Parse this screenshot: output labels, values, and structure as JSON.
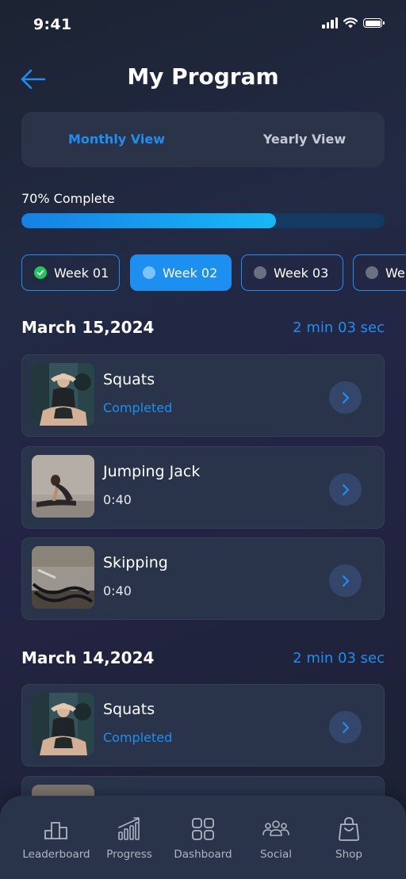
{
  "status_bar": {
    "time": "9:41"
  },
  "header": {
    "title": "My Program"
  },
  "view_toggle": {
    "active": "Monthly View",
    "inactive": "Yearly View"
  },
  "progress": {
    "label": "70% Complete",
    "value": 0.7
  },
  "weeks": [
    {
      "label": "Week 01",
      "state": "completed"
    },
    {
      "label": "Week 02",
      "state": "active"
    },
    {
      "label": "Week 03",
      "state": "upcoming"
    },
    {
      "label": "We",
      "state": "upcoming"
    }
  ],
  "sections": [
    {
      "date": "March 15,2024",
      "duration": "2 min 03 sec",
      "exercises": [
        {
          "name": "Squats",
          "status": "Completed"
        },
        {
          "name": "Jumping Jack",
          "status": "0:40"
        },
        {
          "name": "Skipping",
          "status": "0:40"
        }
      ]
    },
    {
      "date": "March 14,2024",
      "duration": "2 min 03 sec",
      "exercises": [
        {
          "name": "Squats",
          "status": "Completed"
        }
      ]
    }
  ],
  "bottom_nav": [
    {
      "label": "Leaderboard",
      "icon": "leaderboard-icon"
    },
    {
      "label": "Progress",
      "icon": "progress-icon"
    },
    {
      "label": "Dashboard",
      "icon": "dashboard-icon"
    },
    {
      "label": "Social",
      "icon": "social-icon"
    },
    {
      "label": "Shop",
      "icon": "shop-icon"
    }
  ],
  "colors": {
    "accent": "#1d8ff0",
    "card": "#29344b",
    "completed_dot": "#1fc65c"
  }
}
